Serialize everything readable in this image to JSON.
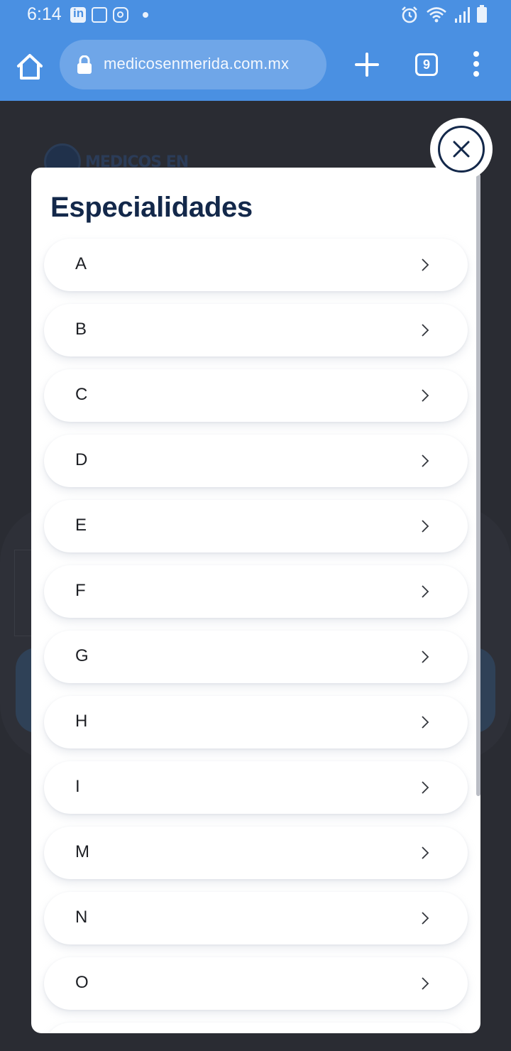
{
  "status_bar": {
    "time": "6:14",
    "left_icons": [
      "linkedin-icon",
      "gmail-icon",
      "instagram-icon",
      "notification-dot-icon"
    ],
    "right_icons": [
      "alarm-icon",
      "wifi-icon",
      "signal-icon",
      "battery-icon"
    ]
  },
  "browser": {
    "url": "medicosenmerida.com.mx",
    "tab_count": "9"
  },
  "background_page": {
    "logo_text": "MEDICOS EN"
  },
  "modal": {
    "title": "Especialidades",
    "items": [
      {
        "label": "A"
      },
      {
        "label": "B"
      },
      {
        "label": "C"
      },
      {
        "label": "D"
      },
      {
        "label": "E"
      },
      {
        "label": "F"
      },
      {
        "label": "G"
      },
      {
        "label": "H"
      },
      {
        "label": "I"
      },
      {
        "label": "M"
      },
      {
        "label": "N"
      },
      {
        "label": "O"
      },
      {
        "label": ""
      }
    ]
  },
  "colors": {
    "browser_bar": "#4a90e2",
    "url_field": "#6fa6e8",
    "title": "#13284a",
    "overlay": "#2a2c33"
  }
}
